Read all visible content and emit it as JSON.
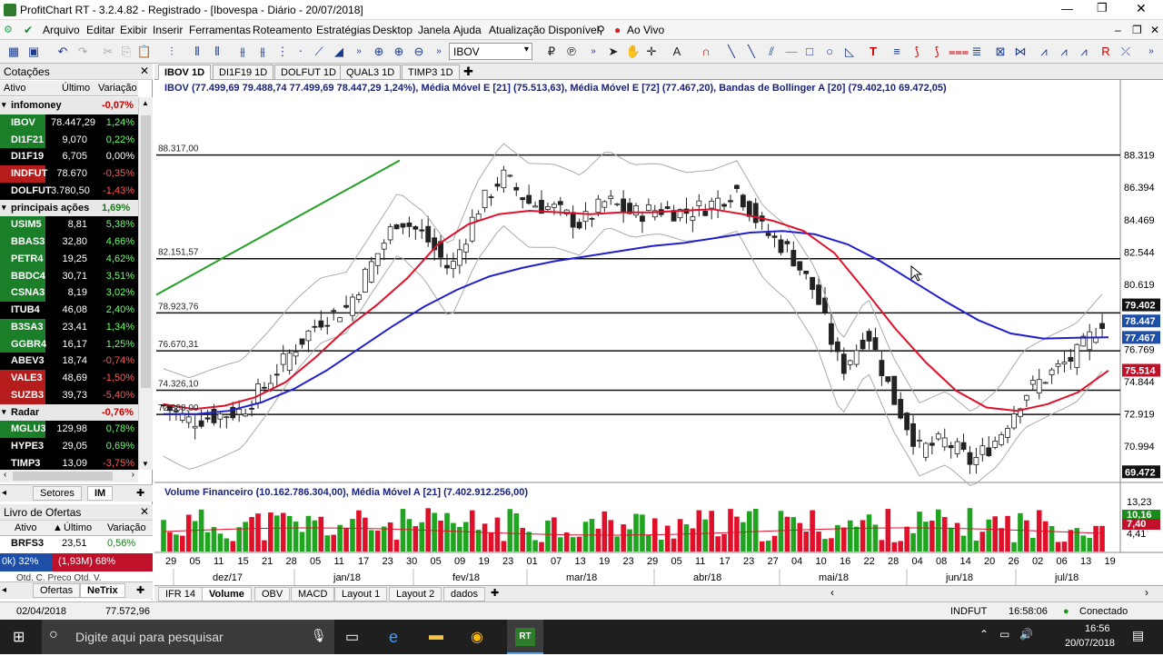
{
  "window": {
    "title": "ProfitChart RT - 3.2.4.82 - Registrado - [Ibovespa - Diário - 20/07/2018]"
  },
  "menu": [
    "Arquivo",
    "Editar",
    "Exibir",
    "Inserir",
    "Ferramentas",
    "Roteamento",
    "Estratégias",
    "Desktop",
    "Janela",
    "Ajuda",
    "Atualização Disponível",
    "Ao Vivo"
  ],
  "toolbar": {
    "symbol": "IBOV"
  },
  "quotes_panel": {
    "title": "Cotações",
    "columns": [
      "Ativo",
      "Último",
      "Variação"
    ],
    "groups": [
      {
        "name": "infomoney",
        "var": "-0,07%",
        "rows": [
          {
            "a": "IBOV",
            "u": "78.447,29",
            "v": "1,24%",
            "bg": "#1b7f2a"
          },
          {
            "a": "DI1F21",
            "u": "9,070",
            "v": "0,22%",
            "bg": "#1b7f2a"
          },
          {
            "a": "DI1F19",
            "u": "6,705",
            "v": "0,00%",
            "bg": "#000000"
          },
          {
            "a": "INDFUT",
            "u": "78.670",
            "v": "-0,35%",
            "bg": "#b71c1c"
          },
          {
            "a": "DOLFUT",
            "u": "3.780,50",
            "v": "-1,43%",
            "bg": "#000000"
          }
        ]
      },
      {
        "name": "principais ações",
        "var": "1,69%",
        "rows": [
          {
            "a": "USIM5",
            "u": "8,81",
            "v": "5,38%",
            "bg": "#1b7f2a"
          },
          {
            "a": "BBAS3",
            "u": "32,80",
            "v": "4,66%",
            "bg": "#1b7f2a"
          },
          {
            "a": "PETR4",
            "u": "19,25",
            "v": "4,62%",
            "bg": "#1b7f2a"
          },
          {
            "a": "BBDC4",
            "u": "30,71",
            "v": "3,51%",
            "bg": "#1b7f2a"
          },
          {
            "a": "CSNA3",
            "u": "8,19",
            "v": "3,02%",
            "bg": "#1b7f2a"
          },
          {
            "a": "ITUB4",
            "u": "46,08",
            "v": "2,40%",
            "bg": "#000000"
          },
          {
            "a": "B3SA3",
            "u": "23,41",
            "v": "1,34%",
            "bg": "#1b7f2a"
          },
          {
            "a": "GGBR4",
            "u": "16,17",
            "v": "1,25%",
            "bg": "#1b7f2a"
          },
          {
            "a": "ABEV3",
            "u": "18,74",
            "v": "-0,74%",
            "bg": "#000000"
          },
          {
            "a": "VALE3",
            "u": "48,69",
            "v": "-1,50%",
            "bg": "#b71c1c"
          },
          {
            "a": "SUZB3",
            "u": "39,73",
            "v": "-5,40%",
            "bg": "#b71c1c"
          }
        ]
      },
      {
        "name": "Radar",
        "var": "-0,76%",
        "rows": [
          {
            "a": "MGLU3",
            "u": "129,98",
            "v": "0,78%",
            "bg": "#1b7f2a"
          },
          {
            "a": "HYPE3",
            "u": "29,05",
            "v": "0,69%",
            "bg": "#000000"
          },
          {
            "a": "TIMP3",
            "u": "13,09",
            "v": "-3,75%",
            "bg": "#000000"
          }
        ]
      }
    ],
    "bottom_tabs": [
      "Setores",
      "IM"
    ]
  },
  "book": {
    "title": "Livro de Ofertas",
    "cols": [
      "Ativo",
      "Último",
      "Variação"
    ],
    "row": {
      "a": "BRFS3",
      "u": "23,51",
      "v": "0,56%"
    },
    "bars": [
      "0k) 32%",
      "(1,93M) 68%"
    ],
    "cut": "Qtd. C.   Preço   Qtd. V.",
    "tabs": [
      "Ofertas",
      "NeTrix"
    ]
  },
  "chart_tabs": [
    "IBOV 1D",
    "DI1F19 1D",
    "DOLFUT 1D",
    "QUAL3 1D",
    "TIMP3 1D"
  ],
  "indicator_line": "IBOV (77.499,69  79.488,74  77.499,69  78.447,29  1,24%), Média Móvel E [21] (75.513,63), Média Móvel E [72] (77.467,20), Bandas de Bollinger A [20] (79.402,10  69.472,05)",
  "volume_line": "Volume Financeiro (10.162.786.304,00), Média Móvel A [21] (7.402.912.256,00)",
  "chart_data": {
    "type": "candlestick",
    "y_ticks": [
      "88.319",
      "86.394",
      "84.469",
      "82.544",
      "80.619",
      "79.402",
      "78.447",
      "77.467",
      "76.769",
      "75.514",
      "74.844",
      "72.919",
      "70.994",
      "69.472"
    ],
    "price_levels": [
      "88.317,00",
      "82.151,57",
      "78.923,76",
      "76.670,31",
      "74.326,10",
      "72.888,00"
    ],
    "x_ticks": [
      "29",
      "05",
      "11",
      "15",
      "21",
      "28",
      "05",
      "11",
      "17",
      "23",
      "30",
      "05",
      "09",
      "19",
      "23",
      "01",
      "07",
      "13",
      "19",
      "23",
      "29",
      "05",
      "11",
      "17",
      "23",
      "27",
      "04",
      "10",
      "16",
      "22",
      "28",
      "04",
      "08",
      "14",
      "20",
      "26",
      "02",
      "06",
      "13",
      "19"
    ],
    "months": [
      "dez/17",
      "jan/18",
      "fev/18",
      "mar/18",
      "abr/18",
      "mai/18",
      "jun/18",
      "jul/18"
    ],
    "volume_ticks": [
      "13,23",
      "10,16",
      "7,40",
      "4,41"
    ],
    "ema21": [
      73.5,
      73.2,
      73.4,
      73.9,
      74.8,
      76.3,
      78.0,
      79.4,
      81.0,
      83.0,
      84.2,
      84.8,
      85.0,
      84.9,
      84.8,
      84.9,
      84.9,
      85.0,
      85.1,
      84.8,
      84.4,
      83.8,
      82.5,
      80.3,
      78.0,
      76.0,
      74.3,
      73.3,
      73.1,
      73.5,
      74.2,
      75.5
    ],
    "ema72": [
      72.9,
      72.9,
      73.1,
      73.6,
      74.4,
      75.5,
      76.8,
      78.1,
      79.3,
      80.3,
      81.1,
      81.6,
      82.0,
      82.3,
      82.6,
      82.9,
      83.1,
      83.4,
      83.7,
      83.8,
      83.6,
      83.0,
      82.0,
      80.8,
      79.6,
      78.5,
      77.7,
      77.4,
      77.45,
      77.47
    ],
    "closes": [
      73.4,
      72.5,
      72.8,
      73.1,
      74.8,
      76.8,
      78.5,
      79.2,
      81.9,
      84.6,
      83.5,
      81.4,
      85.0,
      87.1,
      85.5,
      85.1,
      84.2,
      85.6,
      84.8,
      85.1,
      84.9,
      85.4,
      86.3,
      83.8,
      82.6,
      80.1,
      75.5,
      77.8,
      73.8,
      70.8,
      71.3,
      70.0,
      71.5,
      74.1,
      75.3,
      76.4,
      78.45
    ]
  },
  "bottom_tabs": [
    "IFR 14",
    "Volume",
    "OBV",
    "MACD",
    "Layout 1",
    "Layout 2",
    "dados"
  ],
  "status": {
    "date": "02/04/2018",
    "value": "77.572,96",
    "asset": "INDFUT",
    "time": "16:58:06",
    "conn": "Conectado"
  },
  "taskbar": {
    "search": "Digite aqui para pesquisar",
    "time": "16:56",
    "date": "20/07/2018"
  },
  "colors": {
    "up": "#1fa51f",
    "down": "#e0102a",
    "ema21": "#e0102a",
    "ema72": "#2020d0",
    "boll": "#aaaaaa",
    "trend": "#22a022"
  }
}
